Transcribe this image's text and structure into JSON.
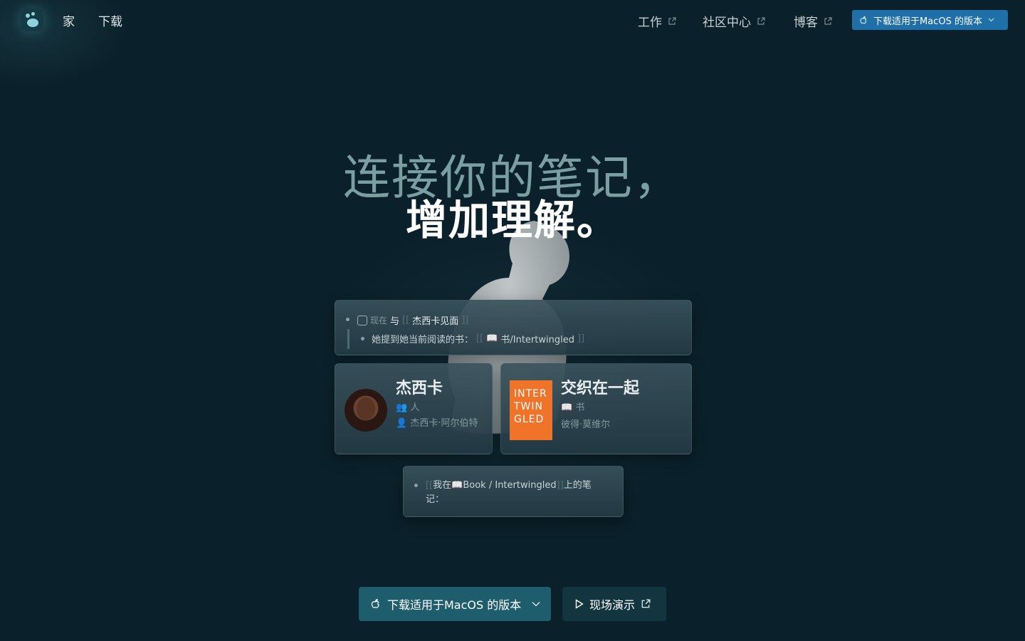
{
  "nav": {
    "home": "家",
    "download": "下载",
    "work": "工作",
    "community": "社区中心",
    "blog": "博客",
    "cta_label": "下载适用于MacOS 的版本"
  },
  "hero": {
    "line1": "连接你的笔记，",
    "line2": "增加理解。"
  },
  "note_card": {
    "checkbox_prefix": "现在",
    "line1_text": "与",
    "line1_link": "杰西卡见面",
    "line2_text": "她提到她当前阅读的书：",
    "line2_link": "书/Intertwingled"
  },
  "person_card": {
    "title": "杰西卡",
    "type_icon": "people-icon",
    "type": "人",
    "detail_icon": "person-icon",
    "detail": "杰西卡·阿尔伯特"
  },
  "book_card": {
    "title": "交织在一起",
    "cover_text": [
      "INTER",
      "TWIN",
      "GLED"
    ],
    "type_icon": "book-icon",
    "type": "书",
    "author": "彼得·莫维尔"
  },
  "notes_card": {
    "prefix": "我在",
    "link": "Book / Intertwingled",
    "suffix_line1": "上的笔",
    "suffix_line2": "记："
  },
  "buttons": {
    "primary": "下载适用于MacOS 的版本",
    "secondary": "现场演示"
  },
  "colors": {
    "background": "#0a202a",
    "accent": "#1f6fa8",
    "primary_button": "#1e5d6c",
    "book_cover": "#f0732a"
  }
}
